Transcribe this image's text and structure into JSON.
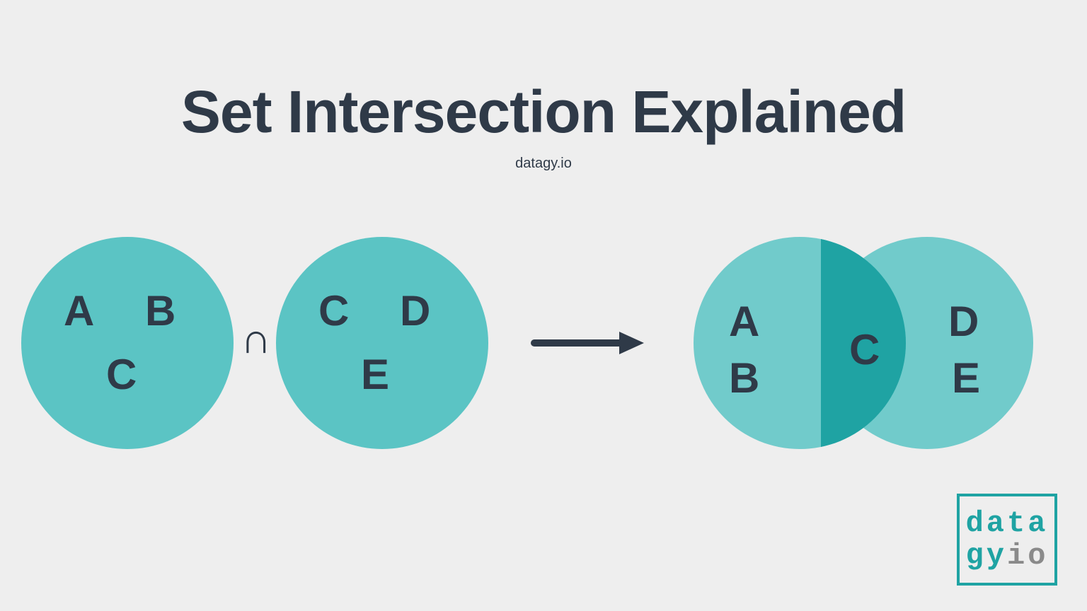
{
  "title": "Set Intersection Explained",
  "subtitle": "datagy.io",
  "set_a": {
    "elements": [
      "A",
      "B",
      "C"
    ]
  },
  "set_b": {
    "elements": [
      "C",
      "D",
      "E"
    ]
  },
  "intersection_symbol": "∩",
  "result": {
    "left_only": [
      "A",
      "B"
    ],
    "intersection": [
      "C"
    ],
    "right_only": [
      "D",
      "E"
    ]
  },
  "logo": {
    "line1_a": "data",
    "line2_a": "gy",
    "line2_b": "io"
  },
  "colors": {
    "background": "#eeeeee",
    "circle": "#5bc4c4",
    "overlap": "#1fa3a3",
    "text": "#2f3a48",
    "logo_accent": "#1fa3a3",
    "logo_gray": "#8a8a8a"
  }
}
